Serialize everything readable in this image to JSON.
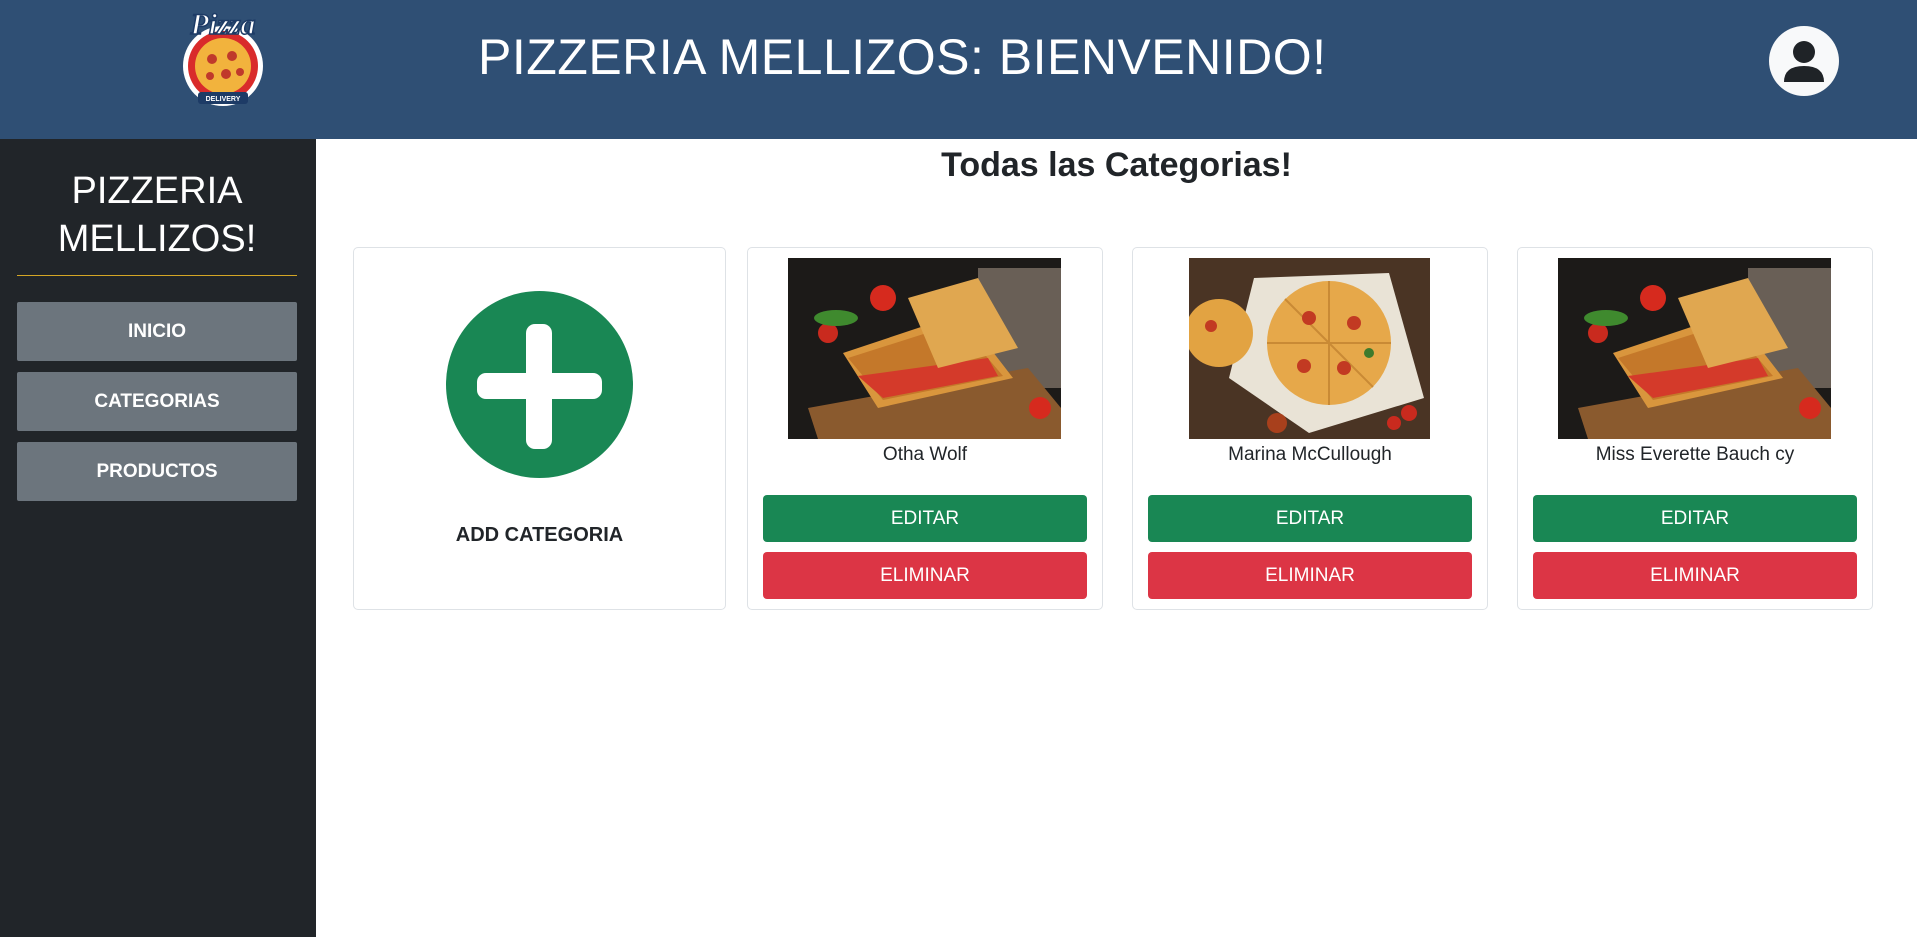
{
  "header": {
    "logo_text": "Pizza",
    "logo_subtext": "DELIVERY",
    "title": "PIZZERIA MELLIZOS: BIENVENIDO!",
    "avatar_icon": "user-icon"
  },
  "sidebar": {
    "brand_line1": "PIZZERIA",
    "brand_line2": "MELLIZOS!",
    "items": [
      {
        "label": "INICIO"
      },
      {
        "label": "CATEGORIAS"
      },
      {
        "label": "PRODUCTOS"
      }
    ]
  },
  "main": {
    "title": "Todas las Categorias!",
    "add_card": {
      "label": "ADD CATEGORIA",
      "icon": "plus-icon"
    },
    "categories": [
      {
        "name": "Otha Wolf",
        "image": "sandwich-photo",
        "edit_label": "EDITAR",
        "delete_label": "ELIMINAR"
      },
      {
        "name": "Marina McCullough",
        "image": "pizza-photo",
        "edit_label": "EDITAR",
        "delete_label": "ELIMINAR"
      },
      {
        "name": "Miss Everette Bauch cy",
        "image": "sandwich-photo",
        "edit_label": "EDITAR",
        "delete_label": "ELIMINAR"
      }
    ]
  },
  "colors": {
    "header_bg": "#2f4f74",
    "sidebar_bg": "#212529",
    "nav_button_bg": "#6c757d",
    "success": "#198754",
    "danger": "#dc3545",
    "divider": "#d4a625"
  }
}
